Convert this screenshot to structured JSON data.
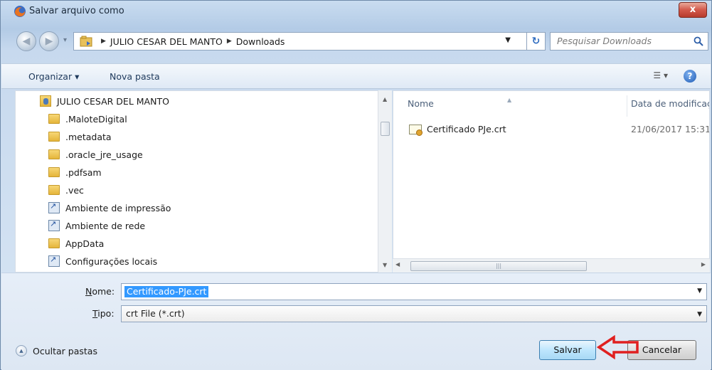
{
  "window": {
    "title": "Salvar arquivo como",
    "close_label": "x"
  },
  "nav": {
    "breadcrumb": [
      "JULIO CESAR DEL MANTO",
      "Downloads"
    ],
    "search_placeholder": "Pesquisar Downloads"
  },
  "toolbar": {
    "organize_label": "Organizar ▾",
    "new_folder_label": "Nova pasta",
    "views_label": "☰ ▾",
    "help_label": "?"
  },
  "tree": {
    "items": [
      {
        "label": "JULIO CESAR DEL MANTO",
        "icon": "user-folder-icon"
      },
      {
        "label": ".MaloteDigital",
        "icon": "folder-icon"
      },
      {
        "label": ".metadata",
        "icon": "folder-icon"
      },
      {
        "label": ".oracle_jre_usage",
        "icon": "folder-icon"
      },
      {
        "label": ".pdfsam",
        "icon": "folder-icon"
      },
      {
        "label": ".vec",
        "icon": "folder-icon"
      },
      {
        "label": "Ambiente de impressão",
        "icon": "shortcut-icon"
      },
      {
        "label": "Ambiente de rede",
        "icon": "shortcut-icon"
      },
      {
        "label": "AppData",
        "icon": "folder-icon"
      },
      {
        "label": "Configurações locais",
        "icon": "shortcut-icon"
      }
    ]
  },
  "files": {
    "columns": [
      "Nome",
      "Data de modificaç"
    ],
    "rows": [
      {
        "name": "Certificado PJe.crt",
        "date": "21/06/2017 15:31"
      }
    ]
  },
  "form": {
    "name_label_u": "N",
    "name_label_rest": "ome:",
    "name_value": "Certificado-PJe.crt",
    "type_label_u": "T",
    "type_label_rest": "ipo:",
    "type_value": "crt File (*.crt)"
  },
  "footer": {
    "hide_folders_label": "Ocultar pastas",
    "save_label": "Salvar",
    "cancel_label": "Cancelar"
  },
  "colors": {
    "annotation_arrow": "#e02020",
    "selection": "#3399ff"
  }
}
